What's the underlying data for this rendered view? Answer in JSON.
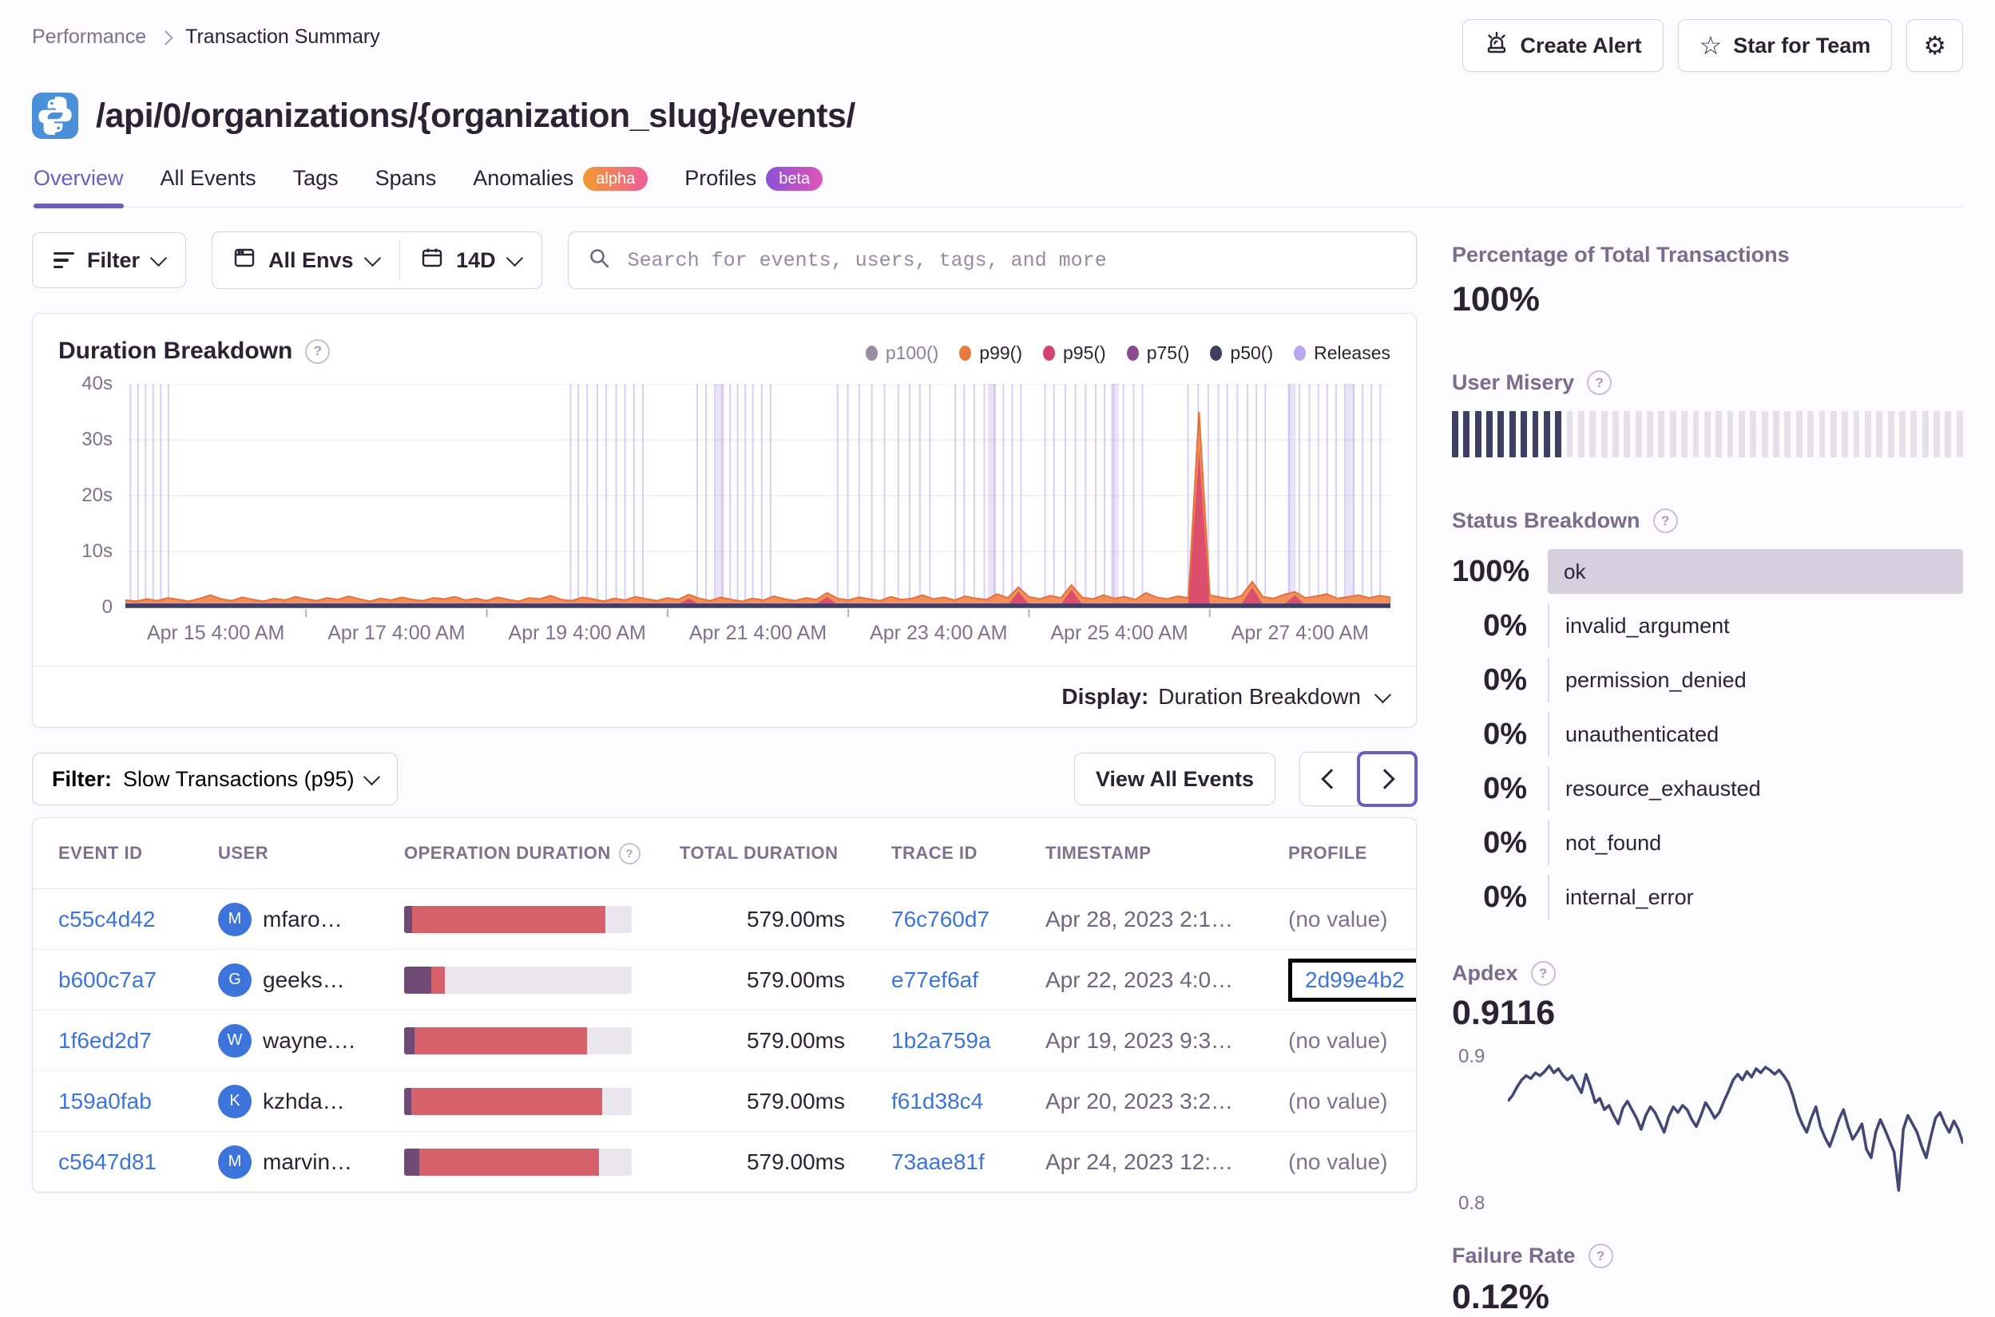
{
  "breadcrumb": [
    "Performance",
    "Transaction Summary"
  ],
  "title": "/api/0/organizations/{organization_slug}/events/",
  "header_actions": {
    "create_alert": "Create Alert",
    "star_for_team": "Star for Team"
  },
  "tabs": [
    {
      "label": "Overview",
      "active": true
    },
    {
      "label": "All Events"
    },
    {
      "label": "Tags"
    },
    {
      "label": "Spans"
    },
    {
      "label": "Anomalies",
      "badge": "alpha"
    },
    {
      "label": "Profiles",
      "badge": "beta"
    }
  ],
  "filter_bar": {
    "filter_label": "Filter",
    "envs_label": "All Envs",
    "period_label": "14D",
    "search_placeholder": "Search for events, users, tags, and more"
  },
  "duration_chart": {
    "title": "Duration Breakdown",
    "display_label": "Display:",
    "display_value": "Duration Breakdown",
    "legend": [
      {
        "label": "p100()",
        "color": "#9b8ba5",
        "muted": true
      },
      {
        "label": "p99()",
        "color": "#e8793f"
      },
      {
        "label": "p95()",
        "color": "#d4436e"
      },
      {
        "label": "p75()",
        "color": "#8e4a8e"
      },
      {
        "label": "p50()",
        "color": "#3f3f63"
      },
      {
        "label": "Releases",
        "color": "#b9a8f0"
      }
    ]
  },
  "chart_data": [
    {
      "type": "area",
      "title": "Duration Breakdown",
      "ylabel": "duration",
      "ylim": [
        0,
        40
      ],
      "unit": "s",
      "y_ticks": [
        "40s",
        "30s",
        "20s",
        "10s",
        "0"
      ],
      "x_ticks": [
        "Apr 15 4:00 AM",
        "Apr 17 4:00 AM",
        "Apr 19 4:00 AM",
        "Apr 21 4:00 AM",
        "Apr 23 4:00 AM",
        "Apr 25 4:00 AM",
        "Apr 27 4:00 AM"
      ],
      "series": [
        {
          "name": "p99()",
          "color": "#ef8a54",
          "stroke": "#e8703a",
          "values": [
            1.3,
            1.1,
            1.5,
            1.2,
            1.7,
            1.4,
            1.1,
            1.6,
            2.2,
            1.5,
            1.2,
            1.8,
            1.4,
            1.1,
            1.6,
            1.3,
            1.9,
            1.5,
            1.2,
            1.7,
            1.4,
            2.0,
            1.5,
            1.1,
            1.6,
            1.3,
            1.8,
            1.4,
            1.2,
            1.7,
            1.5,
            1.9,
            1.3,
            1.6,
            1.2,
            1.8,
            1.4,
            1.1,
            1.7,
            1.5,
            2.1,
            1.4,
            1.2,
            1.8,
            1.5,
            1.1,
            1.6,
            1.3,
            1.9,
            1.5,
            1.2,
            1.7,
            1.4,
            2.3,
            1.6,
            1.2,
            1.8,
            1.4,
            1.1,
            1.6,
            1.3,
            2.0,
            1.5,
            1.2,
            1.7,
            1.4,
            2.6,
            1.6,
            1.3,
            1.8,
            1.5,
            1.2,
            1.9,
            1.4,
            1.6,
            2.2,
            1.5,
            1.8,
            1.3,
            2.0,
            1.6,
            1.4,
            2.4,
            1.7,
            3.6,
            1.9,
            1.5,
            2.1,
            1.7,
            4.0,
            1.8,
            1.5,
            2.2,
            1.6,
            1.9,
            1.4,
            2.6,
            1.8,
            1.5,
            2.0,
            1.7,
            35.0,
            2.2,
            1.8,
            1.5,
            2.1,
            4.6,
            1.9,
            1.6,
            2.3,
            2.8,
            1.7,
            2.0,
            2.4,
            1.6,
            1.9,
            2.2,
            1.7,
            2.1,
            1.8
          ]
        },
        {
          "name": "p95()",
          "color": "#d8486f",
          "values": [
            0.5,
            0.4,
            0.55,
            0.45,
            0.5,
            0.6,
            0.45,
            0.5,
            0.55,
            0.5,
            0.5,
            0.4,
            0.55,
            0.45,
            0.5,
            0.6,
            0.45,
            0.5,
            0.55,
            0.5,
            0.5,
            0.4,
            0.55,
            0.45,
            0.5,
            0.6,
            0.45,
            0.5,
            0.55,
            0.5,
            0.5,
            0.4,
            0.55,
            0.45,
            0.5,
            0.6,
            0.45,
            0.5,
            0.55,
            0.5,
            0.5,
            0.4,
            0.55,
            0.45,
            0.5,
            0.6,
            0.45,
            0.5,
            0.55,
            0.5,
            0.5,
            0.4,
            0.55,
            1.6,
            0.5,
            0.6,
            0.45,
            0.5,
            0.55,
            0.5,
            0.5,
            0.4,
            0.55,
            0.45,
            0.5,
            0.6,
            1.9,
            0.5,
            0.55,
            0.5,
            0.5,
            0.4,
            0.55,
            0.45,
            0.5,
            0.6,
            0.45,
            0.5,
            0.55,
            0.5,
            0.5,
            0.4,
            0.55,
            0.45,
            2.8,
            0.6,
            0.45,
            0.5,
            0.55,
            3.2,
            0.5,
            0.4,
            0.55,
            0.45,
            0.5,
            0.6,
            0.45,
            0.5,
            0.55,
            0.5,
            0.5,
            28.0,
            0.55,
            0.45,
            0.5,
            0.6,
            3.6,
            0.5,
            0.55,
            0.5,
            2.2,
            0.4,
            0.55,
            0.45,
            0.5,
            0.6,
            0.45,
            0.5,
            0.55,
            0.5
          ]
        },
        {
          "name": "p75()",
          "color": "#8e4a8e",
          "baseline": 0.5
        },
        {
          "name": "p50()",
          "color": "#3f3f63",
          "baseline": 0.3
        },
        {
          "name": "p100()",
          "hidden": true
        }
      ],
      "releases": {
        "color": "#b3a1e6",
        "positions": [
          0.004,
          0.01,
          0.016,
          0.022,
          0.028,
          0.034,
          0.352,
          0.358,
          0.365,
          0.373,
          0.38,
          0.388,
          0.395,
          0.402,
          0.409,
          0.452,
          0.459,
          0.466,
          0.472,
          0.478,
          0.484,
          0.49,
          0.496,
          0.503,
          0.51,
          0.563,
          0.571,
          0.58,
          0.59,
          0.6,
          0.611,
          0.62,
          0.628,
          0.636,
          0.656,
          0.663,
          0.671,
          0.679,
          0.687,
          0.694,
          0.701,
          0.708,
          0.727,
          0.734,
          0.743,
          0.751,
          0.759,
          0.767,
          0.774,
          0.781,
          0.789,
          0.797,
          0.804,
          0.84,
          0.848,
          0.856,
          0.864,
          0.871,
          0.879,
          0.887,
          0.894,
          0.901,
          0.92,
          0.928,
          0.936,
          0.943,
          0.95,
          0.957,
          0.964,
          0.971,
          0.978,
          0.985,
          0.992
        ],
        "bands": [
          0.47,
          0.685,
          0.782,
          0.922,
          0.968
        ]
      }
    },
    {
      "type": "line",
      "title": "Apdex",
      "ylim": [
        0.795,
        0.905
      ],
      "y_ticks": [
        "0.9",
        "0.8"
      ],
      "color": "#444674",
      "values": [
        0.868,
        0.872,
        0.878,
        0.883,
        0.886,
        0.884,
        0.888,
        0.886,
        0.889,
        0.893,
        0.888,
        0.891,
        0.886,
        0.883,
        0.886,
        0.88,
        0.874,
        0.887,
        0.878,
        0.867,
        0.87,
        0.862,
        0.865,
        0.858,
        0.852,
        0.863,
        0.868,
        0.862,
        0.856,
        0.848,
        0.858,
        0.864,
        0.86,
        0.853,
        0.846,
        0.857,
        0.864,
        0.86,
        0.865,
        0.862,
        0.855,
        0.85,
        0.858,
        0.867,
        0.862,
        0.856,
        0.86,
        0.868,
        0.875,
        0.883,
        0.887,
        0.883,
        0.889,
        0.885,
        0.891,
        0.888,
        0.892,
        0.89,
        0.887,
        0.89,
        0.886,
        0.881,
        0.872,
        0.86,
        0.852,
        0.846,
        0.856,
        0.864,
        0.85,
        0.842,
        0.836,
        0.845,
        0.855,
        0.862,
        0.85,
        0.841,
        0.846,
        0.852,
        0.834,
        0.828,
        0.846,
        0.855,
        0.848,
        0.84,
        0.832,
        0.805,
        0.848,
        0.858,
        0.852,
        0.846,
        0.836,
        0.828,
        0.843,
        0.856,
        0.86,
        0.852,
        0.846,
        0.854,
        0.848,
        0.838
      ]
    }
  ],
  "events": {
    "filter_label": "Filter:",
    "filter_value": "Slow Transactions (p95)",
    "view_all": "View All Events",
    "columns": [
      "EVENT ID",
      "USER",
      "OPERATION DURATION",
      "TOTAL DURATION",
      "TRACE ID",
      "TIMESTAMP",
      "PROFILE"
    ],
    "rows": [
      {
        "event_id": "c55c4d42",
        "avatar": "M",
        "user": "mfaro…",
        "op": [
          0.035,
          0.85
        ],
        "total": "579.00ms",
        "trace": "76c760d7",
        "timestamp": "Apr 28, 2023 2:1…",
        "profile": "(no value)"
      },
      {
        "event_id": "b600c7a7",
        "avatar": "G",
        "user": "geeks…",
        "op": [
          0.12,
          0.06
        ],
        "total": "579.00ms",
        "trace": "e77ef6af",
        "timestamp": "Apr 22, 2023 4:0…",
        "profile": "2d99e4b2",
        "profile_link": true,
        "highlight": true
      },
      {
        "event_id": "1f6ed2d7",
        "avatar": "W",
        "user": "wayne.…",
        "op": [
          0.045,
          0.76
        ],
        "total": "579.00ms",
        "trace": "1b2a759a",
        "timestamp": "Apr 19, 2023 9:3…",
        "profile": "(no value)"
      },
      {
        "event_id": "159a0fab",
        "avatar": "K",
        "user": "kzhda…",
        "op": [
          0.03,
          0.84
        ],
        "total": "579.00ms",
        "trace": "f61d38c4",
        "timestamp": "Apr 20, 2023 3:2…",
        "profile": "(no value)"
      },
      {
        "event_id": "c5647d81",
        "avatar": "M",
        "user": "marvin…",
        "op": [
          0.065,
          0.79
        ],
        "total": "579.00ms",
        "trace": "73aae81f",
        "timestamp": "Apr 24, 2023 12:…",
        "profile": "(no value)"
      }
    ]
  },
  "sidebar": {
    "pct_total": {
      "title": "Percentage of Total Transactions",
      "value": "100%"
    },
    "misery": {
      "title": "User Misery",
      "filled": 10,
      "total": 45
    },
    "status": {
      "title": "Status Breakdown",
      "rows": [
        {
          "pct": "100%",
          "label": "ok",
          "full": true
        },
        {
          "pct": "0%",
          "label": "invalid_argument"
        },
        {
          "pct": "0%",
          "label": "permission_denied"
        },
        {
          "pct": "0%",
          "label": "unauthenticated"
        },
        {
          "pct": "0%",
          "label": "resource_exhausted"
        },
        {
          "pct": "0%",
          "label": "not_found"
        },
        {
          "pct": "0%",
          "label": "internal_error"
        }
      ]
    },
    "apdex": {
      "title": "Apdex",
      "value": "0.9116",
      "y_top": "0.9",
      "y_bottom": "0.8"
    },
    "failure": {
      "title": "Failure Rate",
      "value": "0.12%"
    }
  }
}
